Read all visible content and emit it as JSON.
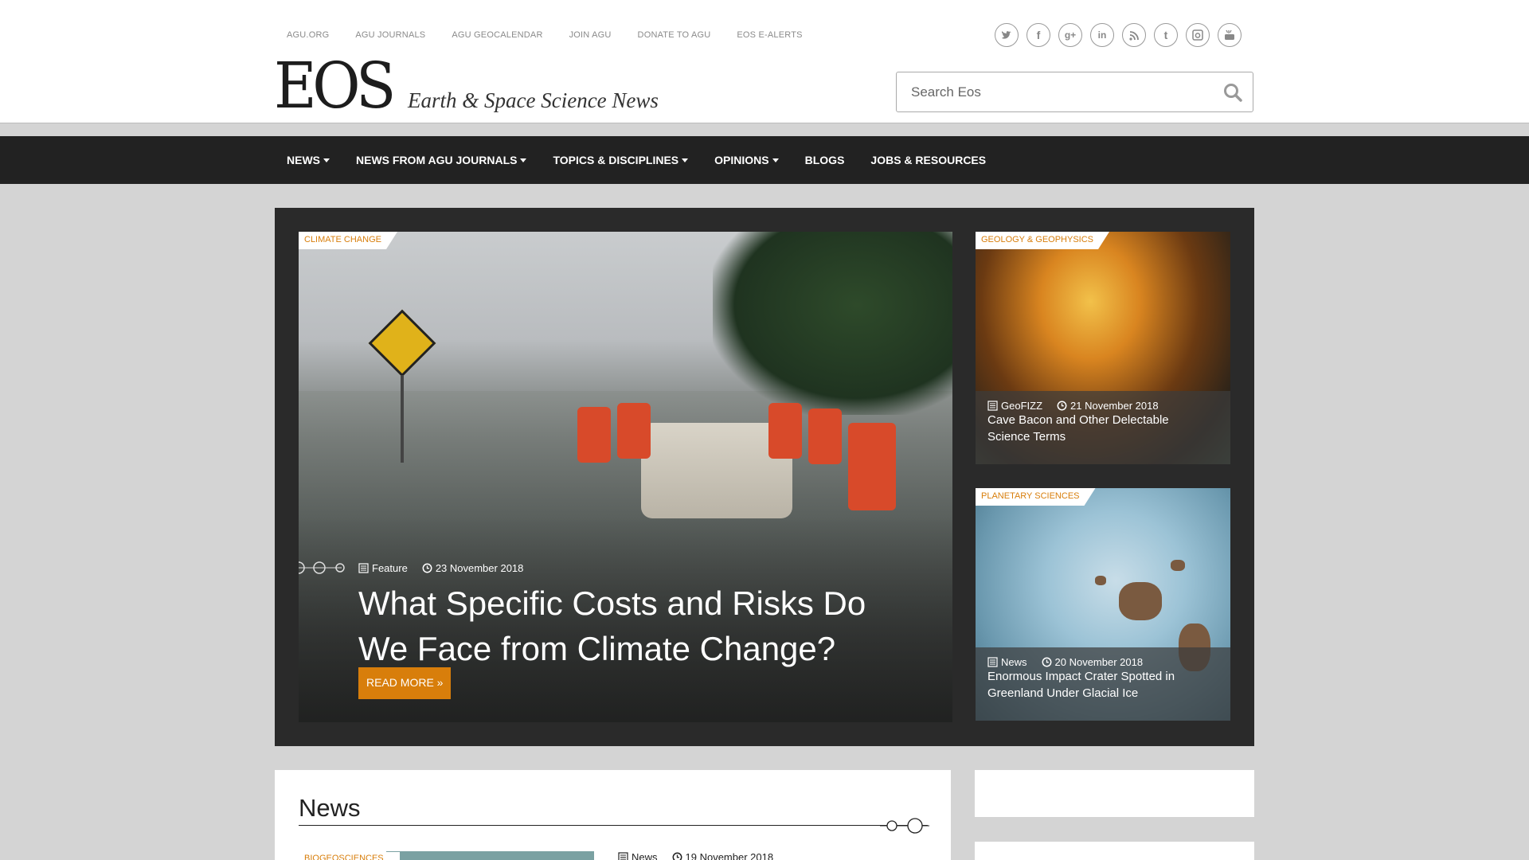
{
  "top_links": [
    "AGU.ORG",
    "AGU JOURNALS",
    "AGU GEOCALENDAR",
    "JOIN AGU",
    "DONATE TO AGU",
    "EOS E-ALERTS"
  ],
  "social_icons": [
    "twitter-icon",
    "facebook-icon",
    "google-plus-icon",
    "linkedin-icon",
    "rss-icon",
    "tumblr-icon",
    "instagram-icon",
    "youtube-icon"
  ],
  "logo": "EOS",
  "tagline": "Earth & Space Science News",
  "search": {
    "placeholder": "Search Eos"
  },
  "nav": {
    "items": [
      {
        "label": "NEWS",
        "dropdown": true
      },
      {
        "label": "NEWS FROM AGU JOURNALS",
        "dropdown": true
      },
      {
        "label": "TOPICS & DISCIPLINES",
        "dropdown": true
      },
      {
        "label": "OPINIONS",
        "dropdown": true
      },
      {
        "label": "BLOGS",
        "dropdown": false
      },
      {
        "label": "JOBS & RESOURCES",
        "dropdown": false
      }
    ]
  },
  "hero": {
    "main": {
      "category": "CLIMATE CHANGE",
      "type": "Feature",
      "date": "23 November 2018",
      "title": "What Specific Costs and Risks Do We Face from Climate Change?",
      "button": "READ MORE »"
    },
    "side1": {
      "category": "GEOLOGY & GEOPHYSICS",
      "type": "GeoFIZZ",
      "date": "21 November 2018",
      "title": "Cave Bacon and Other Delectable Science Terms"
    },
    "side2": {
      "category": "PLANETARY SCIENCES",
      "type": "News",
      "date": "20 November 2018",
      "title": "Enormous Impact Crater Spotted in Greenland Under Glacial Ice"
    }
  },
  "news_section": {
    "title": "News",
    "first_item": {
      "category": "BIOGEOSCIENCES",
      "type": "News",
      "date": "19 November 2018"
    }
  },
  "colors": {
    "accent": "#d87e0b",
    "nav_bg": "#222222",
    "hero_bg": "#2a2a2a",
    "page_bg": "#d4d4d4"
  }
}
